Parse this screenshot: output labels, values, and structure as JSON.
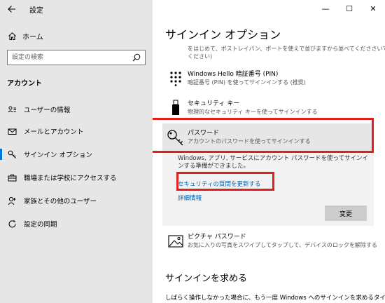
{
  "window": {
    "app_title": "設定",
    "back_icon": "back-arrow-icon",
    "controls": {
      "minimize": "—",
      "maximize": "☐",
      "close": "✕"
    }
  },
  "sidebar": {
    "home_label": "ホーム",
    "search_placeholder": "設定の検索",
    "section_heading": "アカウント",
    "items": [
      {
        "label": "ユーザーの情報",
        "icon": "user-info-icon",
        "active": false
      },
      {
        "label": "メールとアカウント",
        "icon": "mail-icon",
        "active": false
      },
      {
        "label": "サインイン オプション",
        "icon": "key-icon",
        "active": true
      },
      {
        "label": "職場または学校にアクセスする",
        "icon": "briefcase-icon",
        "active": false
      },
      {
        "label": "家族とその他のユーザー",
        "icon": "add-user-icon",
        "active": false
      },
      {
        "label": "設定の同期",
        "icon": "sync-icon",
        "active": false
      }
    ]
  },
  "main": {
    "page_title": "サインイン オプション",
    "truncated_line1": "をはじめて、ポストレイパン、ポートを使えで並びますから並べてくだささいでくれ",
    "truncated_line2": "ください)",
    "options": {
      "pin": {
        "title": "Windows Hello 暗証番号 (PIN)",
        "desc": "暗証番号 (PIN) を使ってサインインする (推奨)"
      },
      "security_key": {
        "title": "セキュリティ キー",
        "desc": "物理的なセキュリティ キーを使ってサインインする"
      },
      "password": {
        "title": "パスワード",
        "desc": "アカウントのパスワードを使ってサインインする"
      },
      "picture_password": {
        "title": "ピクチャ パスワード",
        "desc": "お気に入りの写真をスワイプしてタップして、デバイスのロックを解除する"
      }
    },
    "password_detail": "Windows, アプリ, サービスにアカウント パスワードを使ってサインインする準備ができました。",
    "security_questions_link": "セキュリティの質問を更新する",
    "details_link": "詳細情報",
    "change_button": "変更",
    "require_signin_heading": "サインインを求める",
    "require_signin_text": "しばらく操作しなかった場合に、もう一度 Windows へのサインインを求めるタイ"
  },
  "colors": {
    "sidebar_bg": "#e6e6e6",
    "accent": "#0078d7",
    "link": "#0063b1",
    "highlight_border": "#e02020"
  }
}
